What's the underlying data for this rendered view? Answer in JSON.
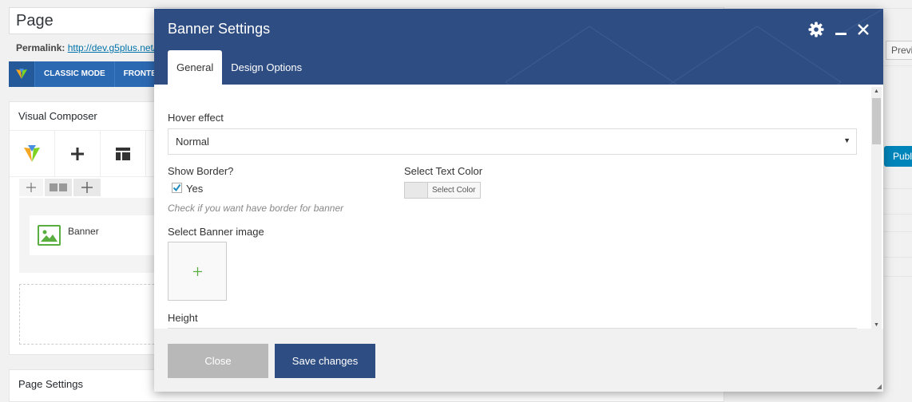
{
  "editor": {
    "title_value": "Page",
    "permalink_label": "Permalink:",
    "permalink_url": "http://dev.g5plus.net/",
    "vc_modes": [
      "CLASSIC MODE",
      "FRONTEND"
    ],
    "vc_panel_title": "Visual Composer",
    "element_label": "Banner",
    "page_settings_title": "Page Settings",
    "preview_label": "Previ",
    "publish_label": "Publ"
  },
  "modal": {
    "title": "Banner Settings",
    "tabs": [
      {
        "label": "General",
        "active": true
      },
      {
        "label": "Design Options",
        "active": false
      }
    ],
    "fields": {
      "hover_effect_label": "Hover effect",
      "hover_effect_value": "Normal",
      "show_border_label": "Show Border?",
      "show_border_option": "Yes",
      "show_border_checked": true,
      "show_border_help": "Check if you want have border for banner",
      "text_color_label": "Select Text Color",
      "text_color_button": "Select Color",
      "banner_image_label": "Select Banner image",
      "height_label": "Height"
    },
    "buttons": {
      "close": "Close",
      "save": "Save changes"
    }
  },
  "colors": {
    "modal_header": "#2e4d82",
    "vc_bar": "#2c69b3",
    "accent_green": "#5aae40",
    "publish": "#0085ba"
  }
}
